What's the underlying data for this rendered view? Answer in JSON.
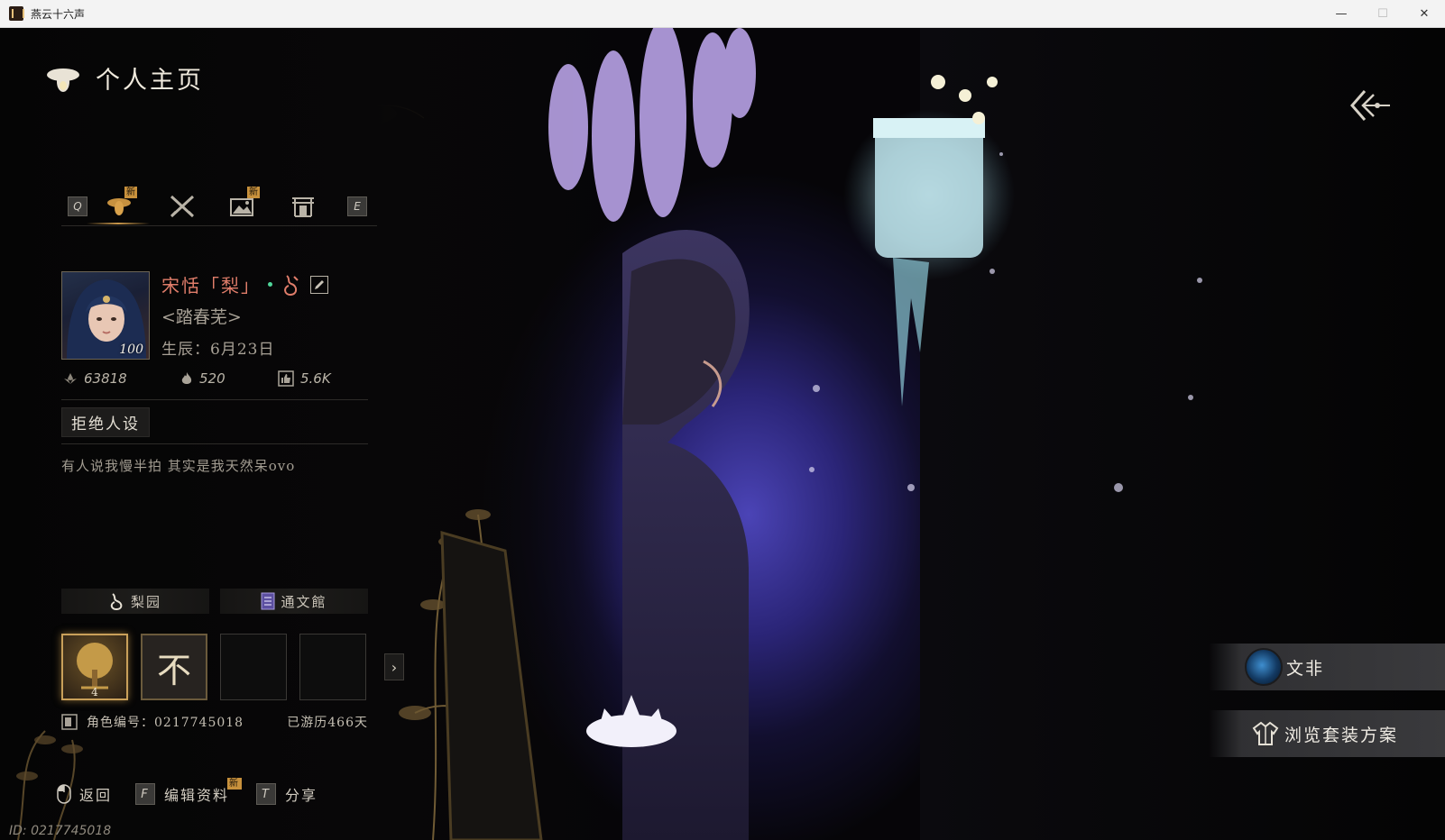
{
  "window": {
    "title": "燕云十六声",
    "minimize": "—",
    "maximize": "☐",
    "close": "✕"
  },
  "header": {
    "title": "个人主页",
    "icon": "firefly-icon"
  },
  "tabs": {
    "prev_key": "Q",
    "next_key": "E",
    "items": [
      {
        "name": "profile",
        "icon": "firefly-icon",
        "badge": "新",
        "active": true
      },
      {
        "name": "combat",
        "icon": "crossed-swords-icon",
        "badge": "",
        "active": false
      },
      {
        "name": "album",
        "icon": "image-icon",
        "badge": "新",
        "active": false
      },
      {
        "name": "home",
        "icon": "gate-icon",
        "badge": "",
        "active": false
      }
    ]
  },
  "profile": {
    "level": "100",
    "name": "宋恬「梨」",
    "guild": "<踏春芜>",
    "birthday": "生辰：6月23日"
  },
  "stats": {
    "popularity": "63818",
    "heat": "520",
    "likes": "5.6K"
  },
  "tag": "拒绝人设",
  "signature": "有人说我慢半拍 其实是我天然呆ovo",
  "affiliations": [
    {
      "label": "梨园",
      "icon": "pear-garden-icon"
    },
    {
      "label": "通文館",
      "icon": "library-icon"
    }
  ],
  "badges": {
    "first_count": "4",
    "second_char": "不"
  },
  "info": {
    "role_id": "角色编号：0217745018",
    "days_traveled": "已游历466天"
  },
  "footer": {
    "back_label": "返回",
    "edit_key": "F",
    "edit_label": "编辑资料",
    "edit_badge": "新",
    "share_key": "T",
    "share_label": "分享",
    "id": "ID: 0217745018"
  },
  "right_buttons": {
    "player_name": "文非",
    "outfit_label": "浏览套装方案"
  },
  "colors": {
    "name": "#e07d6a",
    "accent_gold": "#c9974a",
    "badge_new": "#c8913c",
    "online_dot": "#4fd69a"
  }
}
